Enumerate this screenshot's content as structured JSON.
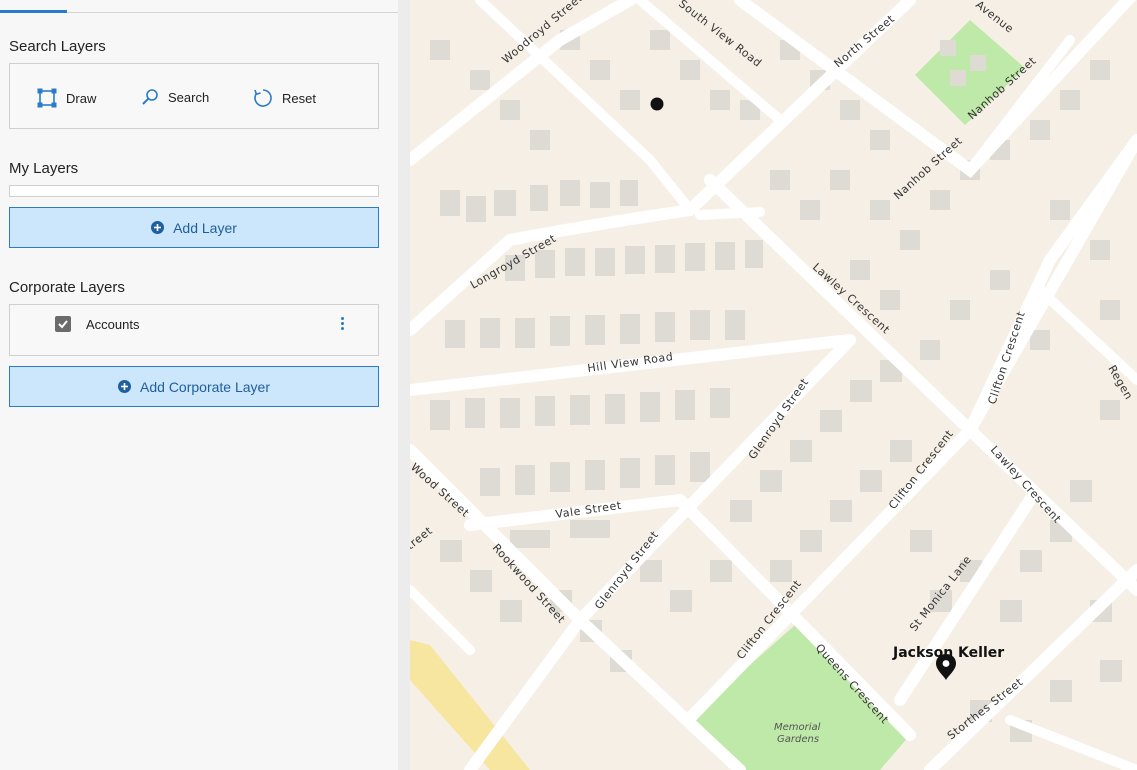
{
  "sidebar": {
    "search_layers": {
      "title": "Search Layers",
      "tools": [
        {
          "label": "Draw",
          "icon": "draw-polygon-icon"
        },
        {
          "label": "Search",
          "icon": "search-icon"
        },
        {
          "label": "Reset",
          "icon": "reset-icon"
        }
      ]
    },
    "my_layers": {
      "title": "My Layers",
      "add_label": "Add Layer"
    },
    "corporate_layers": {
      "title": "Corporate Layers",
      "items": [
        {
          "label": "Accounts",
          "checked": true
        }
      ],
      "add_label": "Add Corporate Layer"
    }
  },
  "map": {
    "streets": [
      "Woodroyd Street",
      "South View Road",
      "North Street",
      "Avenue",
      "Nanhob Street",
      "Longroyd Street",
      "Lawley Crescent",
      "Hill View Road",
      "Clifton Crescent",
      "Regen",
      "Glenroyd Street",
      "Wood Street",
      "Vale Street",
      "treet",
      "Rookwood Street",
      "Glenroyd Street",
      "Clifton Crescent",
      "Lawley Crescent",
      "St Monica Lane",
      "Queens Crescent",
      "Clifton Crescent",
      "Storthes Street"
    ],
    "park": {
      "name_line1": "Memorial",
      "name_line2": "Gardens"
    },
    "pin": {
      "label": "Jackson Keller",
      "icon": "map-pin-icon"
    },
    "colors": {
      "background": "#f6efe6",
      "road": "#ffffff",
      "building": "#dedbd5",
      "park": "#bfe9a8",
      "highway": "#f7e6a0",
      "accent": "#2b7bc9"
    }
  }
}
